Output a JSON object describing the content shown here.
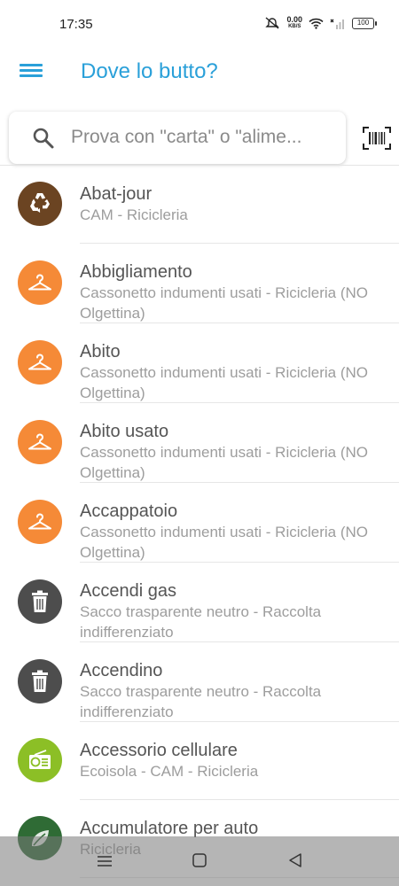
{
  "status": {
    "time": "17:35",
    "speed_value": "0.00",
    "speed_unit": "KB/S",
    "battery": "100"
  },
  "app_bar": {
    "title": "Dove lo butto?"
  },
  "search": {
    "placeholder": "Prova con \"carta\" o \"alime..."
  },
  "items": [
    {
      "title": "Abat-jour",
      "subtitle": "CAM - Ricicleria",
      "icon": "recycle-icon",
      "color": "#6b4422"
    },
    {
      "title": "Abbigliamento",
      "subtitle": "Cassonetto indumenti usati - Ricicleria (NO Olgettina)",
      "icon": "hanger-icon",
      "color": "#f58a37"
    },
    {
      "title": "Abito",
      "subtitle": "Cassonetto indumenti usati - Ricicleria (NO Olgettina)",
      "icon": "hanger-icon",
      "color": "#f58a37"
    },
    {
      "title": "Abito usato",
      "subtitle": "Cassonetto indumenti usati - Ricicleria (NO Olgettina)",
      "icon": "hanger-icon",
      "color": "#f58a37"
    },
    {
      "title": "Accappatoio",
      "subtitle": "Cassonetto indumenti usati - Ricicleria (NO Olgettina)",
      "icon": "hanger-icon",
      "color": "#f58a37"
    },
    {
      "title": "Accendi gas",
      "subtitle": "Sacco trasparente neutro - Raccolta indifferenziato",
      "icon": "trash-icon",
      "color": "#4d4d4d"
    },
    {
      "title": "Accendino",
      "subtitle": "Sacco trasparente neutro - Raccolta indifferenziato",
      "icon": "trash-icon",
      "color": "#4d4d4d"
    },
    {
      "title": "Accessorio cellulare",
      "subtitle": "Ecoisola - CAM - Ricicleria",
      "icon": "radio-icon",
      "color": "#8cbf26"
    },
    {
      "title": "Accumulatore per auto",
      "subtitle": "Ricicleria",
      "icon": "leaf-icon",
      "color": "#2f6b35"
    }
  ]
}
